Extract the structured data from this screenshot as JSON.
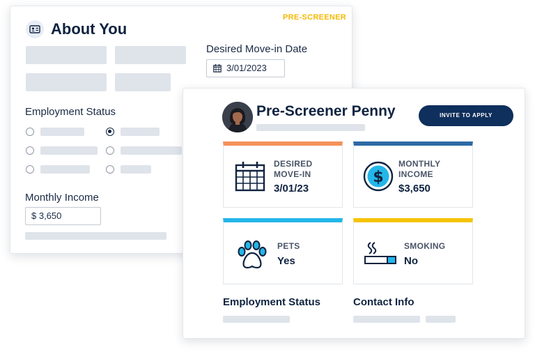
{
  "about": {
    "tag": "PRE-SCREENER",
    "title": "About You",
    "icon": "id-card-icon",
    "move_in_label": "Desired Move-in Date",
    "move_in_value": "3/01/2023",
    "employment_label": "Employment Status",
    "employment_selected_index": 3,
    "income_label": "Monthly Income",
    "income_value": "$ 3,650"
  },
  "penny": {
    "name": "Pre-Screener Penny",
    "invite_button": "INVITE TO APPLY",
    "tiles": [
      {
        "line1": "DESIRED",
        "line2": "MOVE-IN",
        "value": "3/01/23",
        "accent": "#f4925a",
        "icon": "calendar-icon"
      },
      {
        "line1": "MONTHLY",
        "line2": "INCOME",
        "value": "$3,650",
        "accent": "#2e6aa6",
        "icon": "dollar-icon"
      },
      {
        "line1": "PETS",
        "line2": "",
        "value": "Yes",
        "accent": "#23b6e8",
        "icon": "paw-icon"
      },
      {
        "line1": "SMOKING",
        "line2": "",
        "value": "No",
        "accent": "#f5c400",
        "icon": "cigarette-icon"
      }
    ],
    "employment_heading": "Employment Status",
    "contact_heading": "Contact Info"
  },
  "colors": {
    "navy": "#0f2340",
    "button": "#0f2f5c",
    "tag_yellow": "#f5b800",
    "placeholder": "#dfe3ea"
  }
}
